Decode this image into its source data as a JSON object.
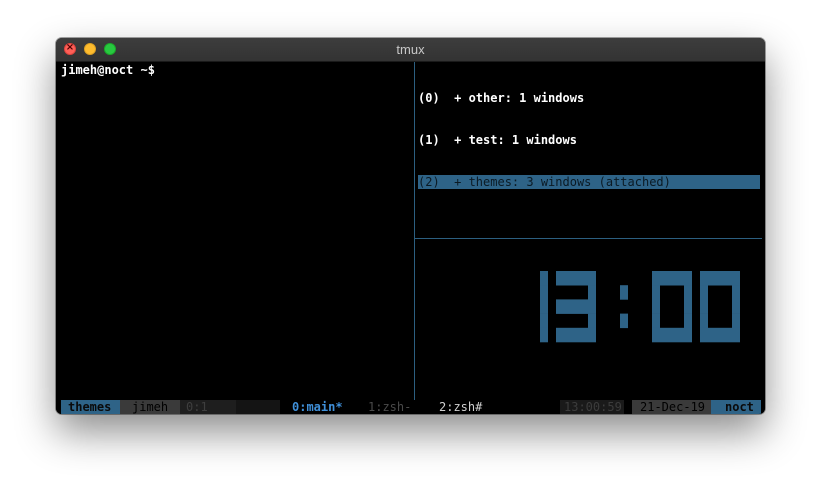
{
  "window": {
    "title": "tmux"
  },
  "terminal": {
    "prompt": "jimeh@noct ~$",
    "sessions": [
      {
        "label": "(0)  + other: 1 windows",
        "active": false
      },
      {
        "label": "(1)  + test: 1 windows",
        "active": false
      },
      {
        "label": "(2)  + themes: 3 windows (attached)",
        "active": true
      }
    ],
    "clock": "13:00"
  },
  "statusbar": {
    "session_name": "themes",
    "user": "jimeh",
    "pane": "0:1",
    "windows": [
      "0:main*",
      "1:zsh-",
      "2:zsh#"
    ],
    "time": "13:00:59",
    "date": "21-Dec-19",
    "host": "noct"
  },
  "colors": {
    "accent": "#2e6387",
    "current_window": "#3f8fd8",
    "pane_border": "#2c5f80",
    "background": "#000000"
  }
}
